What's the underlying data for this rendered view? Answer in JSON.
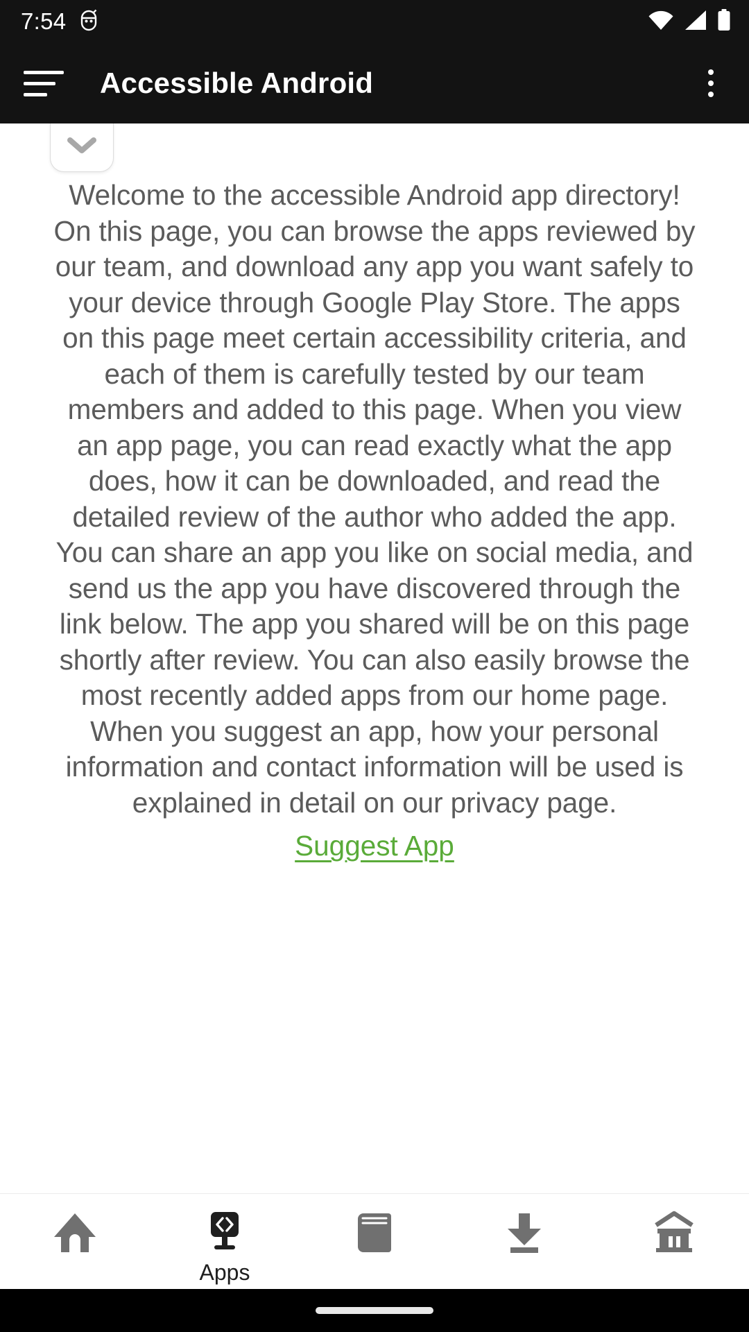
{
  "status_bar": {
    "time": "7:54",
    "icons": [
      "android-debug-icon",
      "wifi-icon",
      "cellular-signal-icon",
      "battery-icon"
    ]
  },
  "app_bar": {
    "menu_icon": "hamburger-menu-icon",
    "title": "Accessible Android",
    "overflow_icon": "more-vertical-icon"
  },
  "content": {
    "collapse_toggle_icon": "chevron-down-icon",
    "intro_paragraph": "Welcome to the accessible Android app directory! On this page, you can browse the apps reviewed by our team, and download any app you want safely to your device through Google Play Store. The apps on this page meet certain accessibility criteria, and each of them is carefully tested by our team members and added to this page. When you view an app page, you can read exactly what the app does, how it can be downloaded, and read the detailed review of the author who added the app. You can share an app you like on social media, and send us the app you have discovered through the link below. The app you shared will be on this page shortly after review. You can also easily browse the most recently added apps from our home page. When you suggest an app, how your personal information and contact information will be used is explained in detail on our privacy page.",
    "suggest_link_label": "Suggest App"
  },
  "bottom_nav": {
    "items": [
      {
        "label": "",
        "icon": "home-icon",
        "selected": false
      },
      {
        "label": "Apps",
        "icon": "apps-monitor-code-icon",
        "selected": true
      },
      {
        "label": "",
        "icon": "book-icon",
        "selected": false
      },
      {
        "label": "",
        "icon": "download-icon",
        "selected": false
      },
      {
        "label": "",
        "icon": "bank-institution-icon",
        "selected": false
      }
    ]
  },
  "system_nav": {
    "home_indicator": "home-gesture-pill"
  },
  "colors": {
    "app_bar_background": "#131313",
    "link_green": "#5aab39",
    "body_text": "#5b5b5b",
    "nav_icon": "#707070",
    "nav_selected": "#1f1f1f"
  }
}
